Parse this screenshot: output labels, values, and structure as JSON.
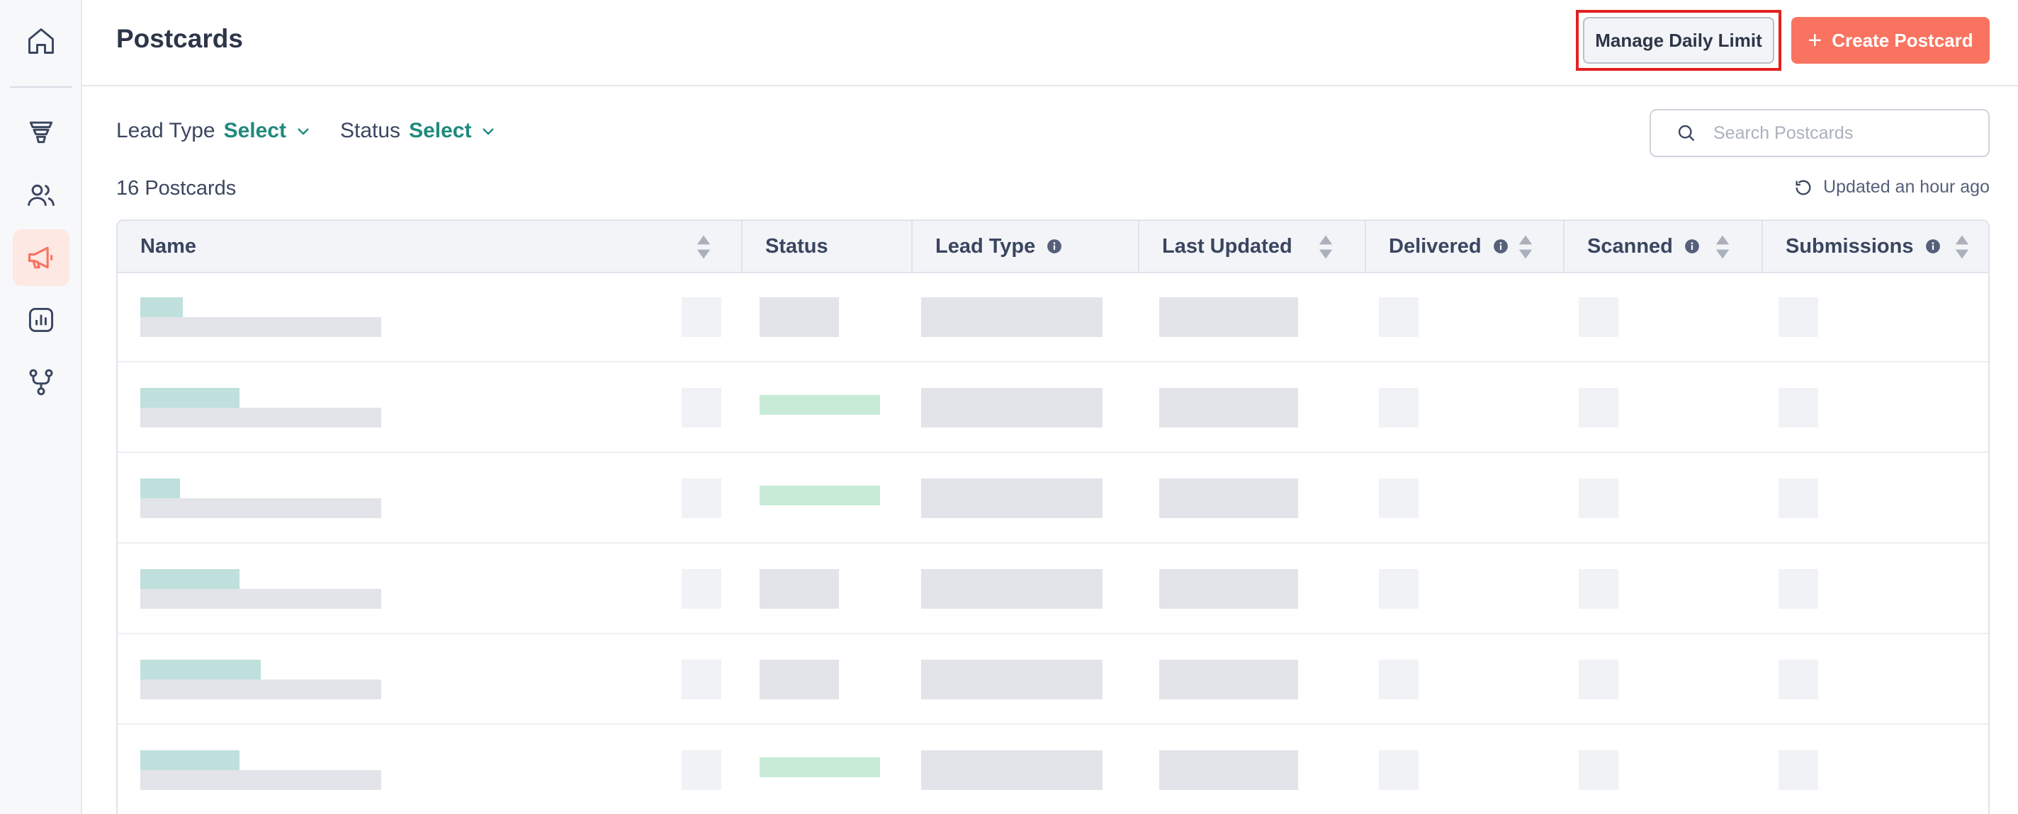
{
  "sidebar": {
    "items": [
      {
        "name": "home-icon",
        "active": false
      },
      {
        "name": "funnel-icon",
        "active": false
      },
      {
        "name": "users-icon",
        "active": false
      },
      {
        "name": "megaphone-icon",
        "active": true
      },
      {
        "name": "analytics-icon",
        "active": false
      },
      {
        "name": "workflow-icon",
        "active": false
      }
    ]
  },
  "header": {
    "title": "Postcards",
    "manage_label": "Manage Daily Limit",
    "create_label": "Create Postcard"
  },
  "filters": {
    "lead_type_label": "Lead Type",
    "lead_type_value": "Select",
    "status_label": "Status",
    "status_value": "Select"
  },
  "search": {
    "placeholder": "Search Postcards"
  },
  "count_text": "16 Postcards",
  "updated_text": "Updated an hour ago",
  "table": {
    "columns": [
      "Name",
      "Status",
      "Lead Type",
      "Last Updated",
      "Delivered",
      "Scanned",
      "Submissions"
    ]
  },
  "colors": {
    "accent": "#f97360",
    "teal": "#1f8a7d",
    "highlight": "#e32020"
  }
}
